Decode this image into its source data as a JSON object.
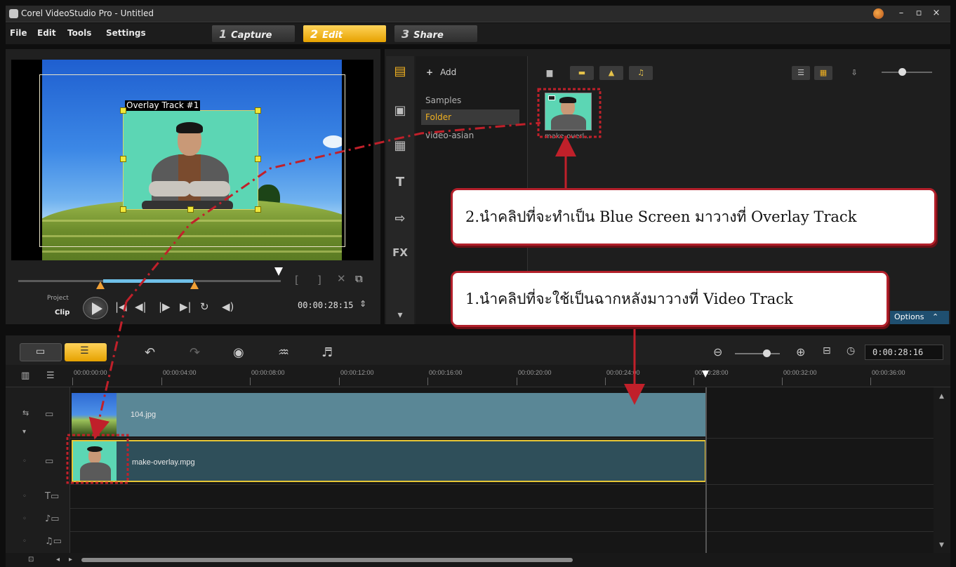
{
  "app": {
    "title": "Corel VideoStudio Pro - Untitled"
  },
  "menu": {
    "items": [
      "File",
      "Edit",
      "Tools",
      "Settings"
    ]
  },
  "steps": [
    {
      "num": "1",
      "label": "Capture"
    },
    {
      "num": "2",
      "label": "Edit"
    },
    {
      "num": "3",
      "label": "Share"
    }
  ],
  "preview": {
    "overlay_label": "Overlay Track #1",
    "project_label": "Project",
    "clip_label": "Clip",
    "timecode": "00:00:28:15"
  },
  "library": {
    "add_label": "Add",
    "folders": [
      "Samples",
      "Folder",
      "video-asian"
    ],
    "thumb_label": "make-overl...",
    "options_label": "Options"
  },
  "callouts": {
    "step2": "2.นำคลิปที่จะทำเป็น  Blue Screen มาวางที่ Overlay Track",
    "step1": "1.นำคลิปที่จะใช้เป็นฉากหลังมาวางที่  Video Track"
  },
  "timeline": {
    "current_time": "0:00:28:16",
    "ruler": [
      "00:00:00:00",
      "00:00:04:00",
      "00:00:08:00",
      "00:00:12:00",
      "00:00:16:00",
      "00:00:20:00",
      "00:00:24:00",
      "00:00:28:00",
      "00:00:32:00",
      "00:00:36:00"
    ],
    "video_clip": "104.jpg",
    "overlay_clip": "make-overlay.mpg"
  },
  "colors": {
    "accent": "#f0b020",
    "callout_border": "#b21f2a",
    "overlay_green": "#5cd6b4"
  }
}
